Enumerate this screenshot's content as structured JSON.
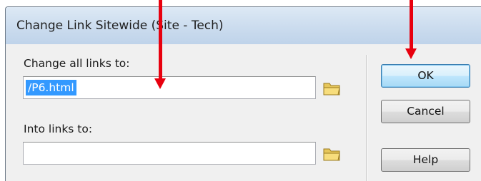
{
  "window": {
    "title": "Change Link Sitewide (Site - Tech)"
  },
  "form": {
    "change_label": "Change all links to:",
    "change_value": "/P6.html",
    "into_label": "Into links to:",
    "into_value": ""
  },
  "buttons": {
    "ok": "OK",
    "cancel": "Cancel",
    "help": "Help"
  },
  "icons": {
    "folder": "folder-icon"
  },
  "colors": {
    "annotation_arrow": "#e8000e",
    "selection": "#3399ff",
    "titlebar": "#cbdcee"
  }
}
